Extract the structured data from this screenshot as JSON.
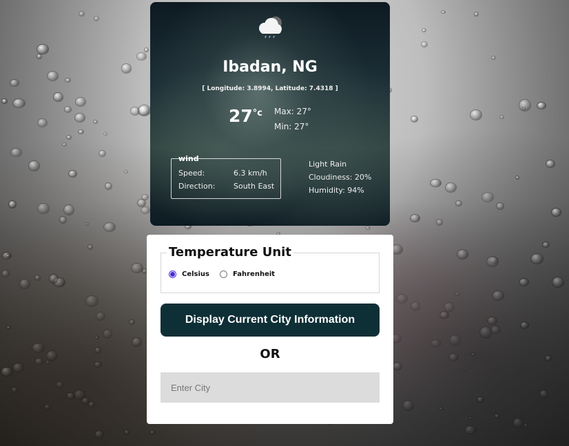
{
  "weather": {
    "city": "Ibadan, NG",
    "coordinates": "[ Longitude: 3.8994, Latitude: 7.4318 ]",
    "temp": "27",
    "temp_unit": "°c",
    "max": "Max: 27°",
    "min": "Min: 27°",
    "icon": "cloud-rain-icon",
    "wind": {
      "legend": "wind",
      "speed_label": "Speed:",
      "speed_value": "6.3 km/h",
      "direction_label": "Direction:",
      "direction_value": "South East"
    },
    "condition": "Light Rain",
    "cloudiness": "Cloudiness: 20%",
    "humidity": "Humidity: 94%"
  },
  "form": {
    "unit_legend": "Temperature Unit",
    "options": [
      {
        "label": "Celsius",
        "selected": true
      },
      {
        "label": "Fahrenheit",
        "selected": false
      }
    ],
    "display_button": "Display Current City Information",
    "or_text": "OR",
    "city_placeholder": "Enter City"
  },
  "colors": {
    "button_bg": "#0f2f36",
    "radio_accent": "#4a2bdc",
    "input_bg": "#dcdcdc"
  }
}
